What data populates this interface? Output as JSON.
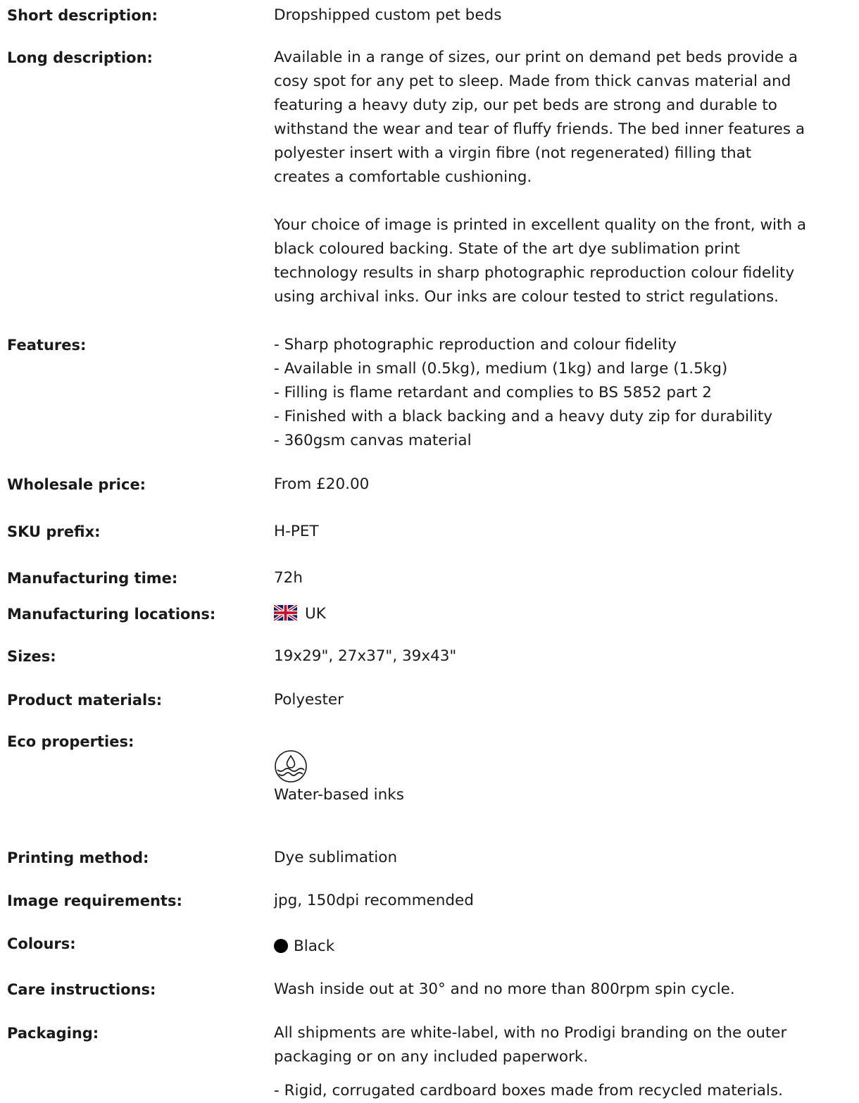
{
  "specs": {
    "short_description": {
      "label": "Short description:",
      "value": "Dropshipped custom pet beds"
    },
    "long_description": {
      "label": "Long description:",
      "lines_p1": [
        "Available in a range of sizes, our print on demand pet beds provide a",
        "cosy spot for any pet to sleep. Made from thick canvas material and",
        "featuring a heavy duty zip, our pet beds are strong and durable to",
        "withstand the wear and tear of fluffy friends. The bed inner features a",
        "polyester insert with a virgin fibre (not regenerated) filling that",
        "creates a comfortable cushioning."
      ],
      "lines_p2": [
        "Your choice of image is printed in excellent quality on the front, with a",
        "black coloured backing. State of the art dye sublimation print",
        "technology results in sharp photographic reproduction colour fidelity",
        "using archival inks. Our inks are colour tested to strict regulations."
      ]
    },
    "features": {
      "label": "Features:",
      "items": [
        "- Sharp photographic reproduction and colour fidelity",
        "- Available in small (0.5kg), medium (1kg) and large (1.5kg)",
        "- Filling is flame retardant and complies to BS 5852 part 2",
        "- Finished with a black backing and a heavy duty zip for durability",
        "- 360gsm canvas material"
      ]
    },
    "wholesale_price": {
      "label": "Wholesale price:",
      "value": "From £20.00"
    },
    "sku_prefix": {
      "label": "SKU prefix:",
      "value": "H-PET"
    },
    "manufacturing_time": {
      "label": "Manufacturing time:",
      "value": "72h"
    },
    "manufacturing_locations": {
      "label": "Manufacturing locations:",
      "value": "UK",
      "flag_icon": "uk-flag-icon"
    },
    "sizes": {
      "label": "Sizes:",
      "value": "19x29\", 27x37\", 39x43\""
    },
    "product_materials": {
      "label": "Product materials:",
      "value": "Polyester"
    },
    "eco_properties": {
      "label": "Eco properties:",
      "icon": "water-drop-waves-icon",
      "value": "Water-based inks"
    },
    "printing_method": {
      "label": "Printing method:",
      "value": "Dye sublimation"
    },
    "image_requirements": {
      "label": "Image requirements:",
      "value": "jpg, 150dpi recommended"
    },
    "colours": {
      "label": "Colours:",
      "value": "Black",
      "swatch_color": "#000000"
    },
    "care_instructions": {
      "label": "Care instructions:",
      "value": "Wash inside out at 30° and no more than 800rpm spin cycle."
    },
    "packaging": {
      "label": "Packaging:",
      "lines_p1": [
        "All shipments are white-label, with no Prodigi branding on the outer",
        "packaging or on any included paperwork."
      ],
      "line_p2": "- Rigid, corrugated cardboard boxes made from recycled materials."
    }
  },
  "colors": {
    "text": "#1a1a1a",
    "background": "#ffffff",
    "flag_blue": "#012169",
    "flag_red": "#C8102E"
  }
}
